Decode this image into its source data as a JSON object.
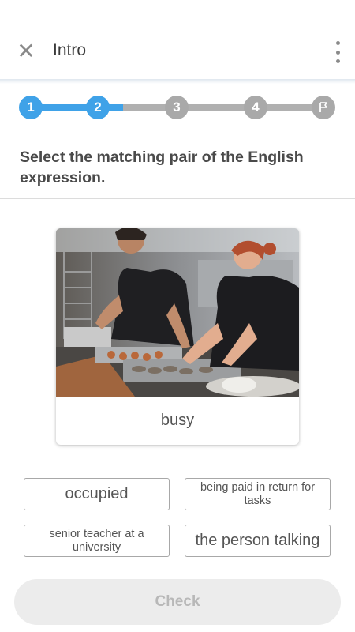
{
  "header": {
    "title": "Intro",
    "close_icon": "close-icon",
    "more_icon": "more-vertical-icon"
  },
  "stepper": {
    "steps": [
      "1",
      "2",
      "3",
      "4"
    ],
    "current_step": 2,
    "final_icon": "flag-icon",
    "progress_fraction": 0.31,
    "active_color": "#3fa2e8",
    "inactive_color": "#a9a9a9"
  },
  "prompt": "Select the matching pair of the English expression.",
  "card": {
    "word": "busy",
    "image_description_icon": "kitchen-photo"
  },
  "options": [
    "occupied",
    "being paid in return for tasks",
    "senior teacher at a university",
    "the person talking"
  ],
  "check_button": {
    "label": "Check",
    "disabled_color": "#ececec"
  }
}
